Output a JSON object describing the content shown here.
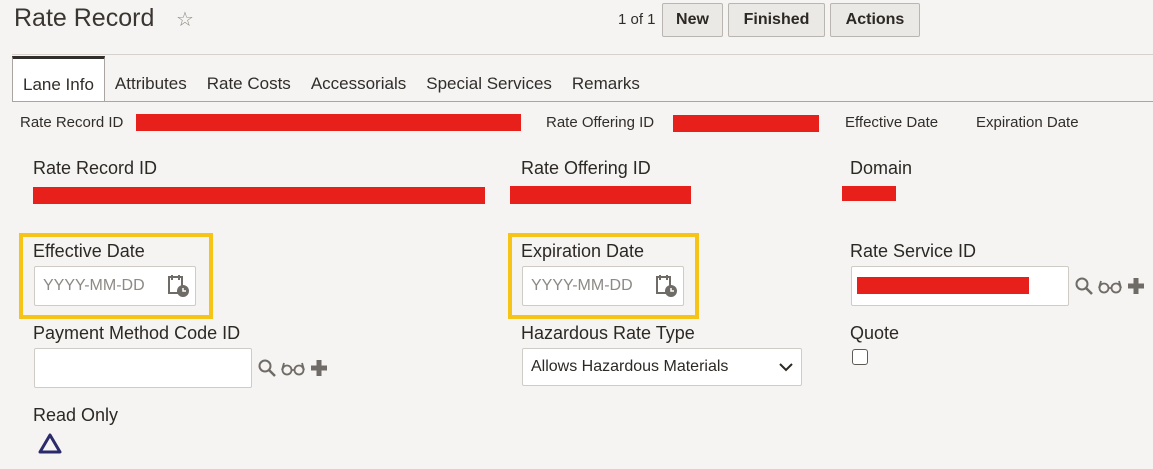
{
  "header": {
    "title": "Rate Record",
    "pager": "1 of 1",
    "buttons": {
      "new": "New",
      "finished": "Finished",
      "actions": "Actions"
    }
  },
  "tabs": [
    "Lane Info",
    "Attributes",
    "Rate Costs",
    "Accessorials",
    "Special Services",
    "Remarks"
  ],
  "summary": {
    "rate_record_id": "Rate Record ID",
    "rate_offering_id": "Rate Offering ID",
    "effective_date": "Effective Date",
    "expiration_date": "Expiration Date"
  },
  "form": {
    "rate_record_id": {
      "label": "Rate Record ID"
    },
    "rate_offering_id": {
      "label": "Rate Offering ID"
    },
    "domain": {
      "label": "Domain"
    },
    "effective_date": {
      "label": "Effective Date",
      "placeholder": "YYYY-MM-DD"
    },
    "expiration_date": {
      "label": "Expiration Date",
      "placeholder": "YYYY-MM-DD"
    },
    "rate_service_id": {
      "label": "Rate Service ID"
    },
    "payment_method_code_id": {
      "label": "Payment Method Code ID"
    },
    "hazardous_rate_type": {
      "label": "Hazardous Rate Type",
      "value": "Allows Hazardous Materials"
    },
    "quote": {
      "label": "Quote"
    },
    "read_only": {
      "label": "Read Only"
    }
  },
  "colors": {
    "highlight": "#f6c416",
    "redaction": "#e8201c",
    "read_only_icon": "#2b2a6b"
  },
  "icons": [
    "star-icon",
    "calendar-icon",
    "search-icon",
    "glasses-icon",
    "plus-icon",
    "chevron-down-icon",
    "triangle-icon"
  ]
}
